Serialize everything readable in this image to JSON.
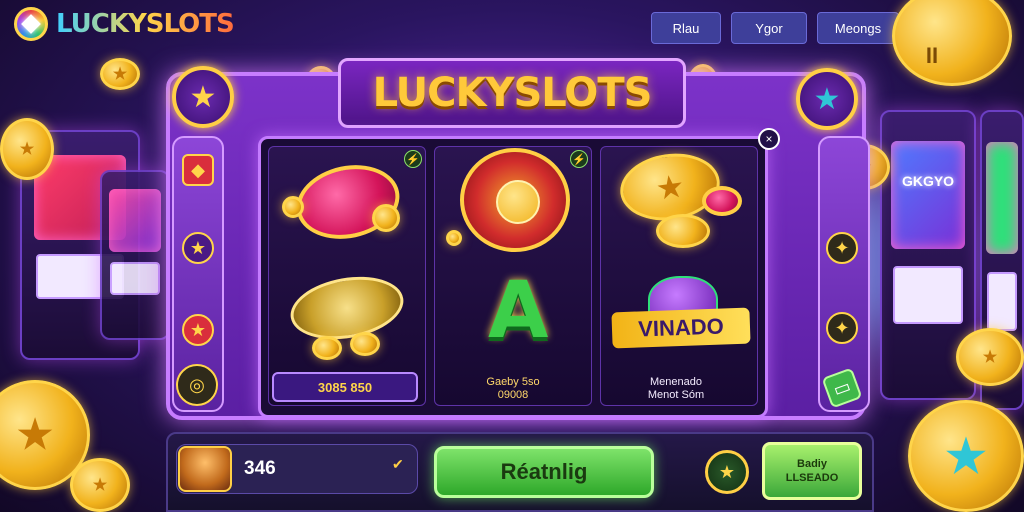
{
  "logo": {
    "text": "LUCKYSLOTS",
    "icon": "gem-icon"
  },
  "topnav": {
    "items": [
      "Rlau",
      "Ygor",
      "Meongs"
    ]
  },
  "pause": {
    "icon": "pause-icon",
    "glyph": "II"
  },
  "title": "LUCKYSLOTS",
  "background": {
    "left_machine_screen": "",
    "right_machine_screen": "GKGYO"
  },
  "close": {
    "glyph": "×"
  },
  "left_column": {
    "icons": [
      "cube-icon",
      "star-icon",
      "star-icon",
      "coin-icon"
    ]
  },
  "right_column": {
    "icons": [
      "sparkle-icon",
      "sparkle-icon",
      "coin-icon",
      "card-icon"
    ]
  },
  "reels": {
    "left": {
      "badge": "⚡",
      "pill_label": "3085 850"
    },
    "middle": {
      "badge": "⚡",
      "caption_line1": "Gaeby 5so",
      "caption_line2": "09008",
      "letter": "A"
    },
    "right": {
      "caption_line1": "Menenado",
      "caption_line2": "Menot Sóm",
      "banner": "VINADO"
    }
  },
  "bottom": {
    "balance": "346",
    "spin_label": "Réatnlig",
    "emblem_glyph": "★",
    "bet_line1": "Badiy",
    "bet_line2": "LLSEADO"
  },
  "colors": {
    "accent_gold": "#ffcf45",
    "frame_purple": "#7c32c9",
    "spin_green": "#2ea82a"
  }
}
